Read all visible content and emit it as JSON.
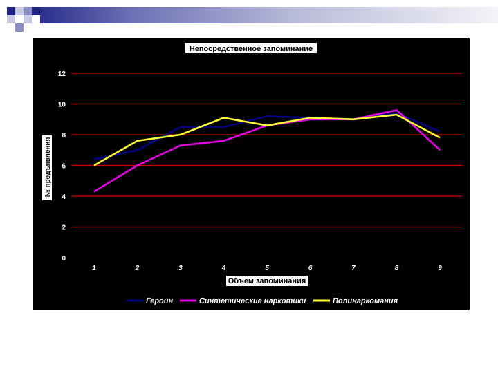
{
  "colors": {
    "background": "#000000",
    "grid": "#cc0000",
    "text": "#ffffff",
    "deco_dark": "#1e2280",
    "deco_mid": "#8b8ec4",
    "deco_light": "#c9cae3"
  },
  "chart_data": {
    "type": "line",
    "title": "Непосредственное запоминание",
    "xlabel": "Объем запоминания",
    "ylabel": "№ предъявления",
    "categories": [
      "1",
      "2",
      "3",
      "4",
      "5",
      "6",
      "7",
      "8",
      "9"
    ],
    "ylim": [
      0,
      12
    ],
    "yticks": [
      "0",
      "2",
      "4",
      "6",
      "8",
      "10",
      "12"
    ],
    "grid": true,
    "legend_position": "bottom",
    "series": [
      {
        "name": "Героин",
        "color": "#000080",
        "values": [
          6.4,
          7.0,
          8.5,
          8.5,
          9.2,
          9.1,
          9.0,
          9.4,
          8.2
        ]
      },
      {
        "name": "Синтетические наркотики",
        "color": "#e600e6",
        "values": [
          4.3,
          6.0,
          7.3,
          7.6,
          8.6,
          9.0,
          9.0,
          9.6,
          7.0
        ]
      },
      {
        "name": "Полинаркомания",
        "color": "#ffff33",
        "values": [
          6.0,
          7.6,
          8.0,
          9.1,
          8.6,
          9.1,
          9.0,
          9.3,
          7.8
        ]
      }
    ]
  }
}
